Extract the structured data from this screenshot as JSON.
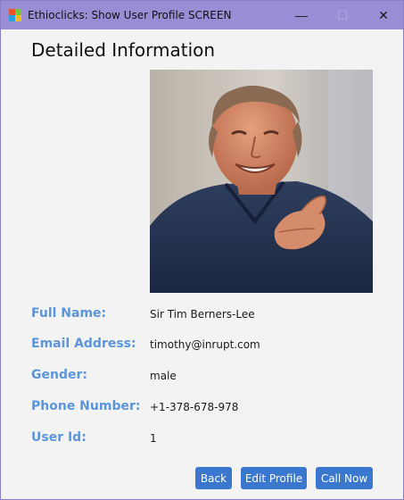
{
  "window": {
    "title": "Ethioclicks: Show User Profile SCREEN",
    "minimize_glyph": "—",
    "maximize_glyph": "☐",
    "close_glyph": "✕"
  },
  "heading": "Detailed Information",
  "profile_photo": {
    "alt": "Sir Tim Berners-Lee"
  },
  "fields": {
    "full_name": {
      "label": "Full Name:",
      "value": "Sir Tim Berners-Lee"
    },
    "email": {
      "label": "Email Address:",
      "value": "timothy@inrupt.com"
    },
    "gender": {
      "label": "Gender:",
      "value": "male"
    },
    "phone": {
      "label": "Phone Number:",
      "value": "+1-378-678-978"
    },
    "user_id": {
      "label": "User Id:",
      "value": "1"
    }
  },
  "buttons": {
    "back": "Back",
    "edit_profile": "Edit Profile",
    "call_now": "Call Now"
  },
  "colors": {
    "titlebar": "#9b8cd6",
    "label": "#5b95dc",
    "button": "#3a78cf"
  }
}
